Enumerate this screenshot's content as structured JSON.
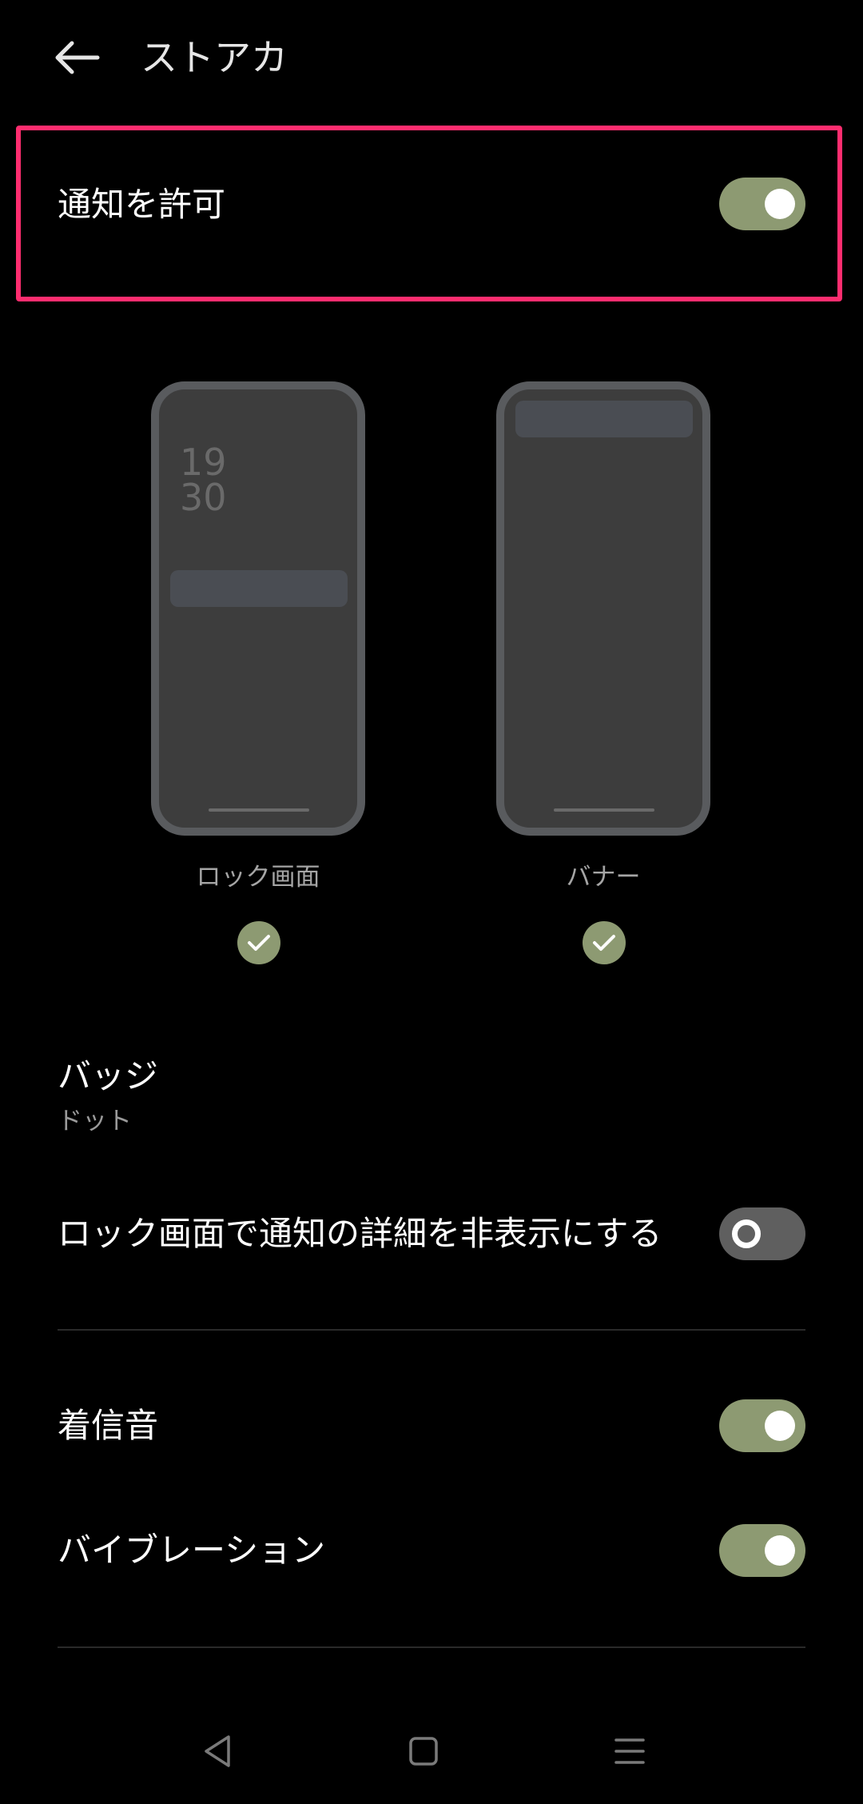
{
  "header": {
    "title": "ストアカ"
  },
  "allow_notifications": {
    "label": "通知を許可",
    "enabled": true
  },
  "previews": {
    "lock_screen": {
      "label": "ロック画面",
      "clock_hour": "19",
      "clock_minute": "30",
      "checked": true
    },
    "banner": {
      "label": "バナー",
      "checked": true
    }
  },
  "badge": {
    "label": "バッジ",
    "value": "ドット"
  },
  "hide_details": {
    "label": "ロック画面で通知の詳細を非表示にする",
    "enabled": false
  },
  "ringtone": {
    "label": "着信音",
    "enabled": true
  },
  "vibration": {
    "label": "バイブレーション",
    "enabled": true
  },
  "colors": {
    "background": "#000000",
    "accent": "#8d9a72",
    "highlight": "#ff2d6f",
    "toggle_off": "#5f5f5f"
  },
  "icons": {
    "back": "arrow-left-icon",
    "check": "check-icon",
    "nav_back": "triangle-back-icon",
    "nav_home": "square-home-icon",
    "nav_menu": "hamburger-menu-icon"
  }
}
